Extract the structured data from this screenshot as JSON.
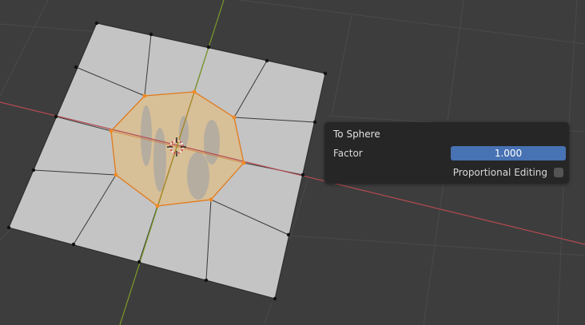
{
  "viewport": {
    "background_color": "#3d3d3d",
    "grid_color": "#4a4a4a",
    "x_axis_color": "#b34a50",
    "y_axis_color": "#7c9a27",
    "mesh_face_color": "#c4c4c4",
    "selection_color": "#f08a24",
    "selected_face_tint": "#d8bf96"
  },
  "redo_panel": {
    "title": "To Sphere",
    "factor_label": "Factor",
    "factor_value": "1.000",
    "proportional_label": "Proportional Editing",
    "proportional_checked": false
  }
}
